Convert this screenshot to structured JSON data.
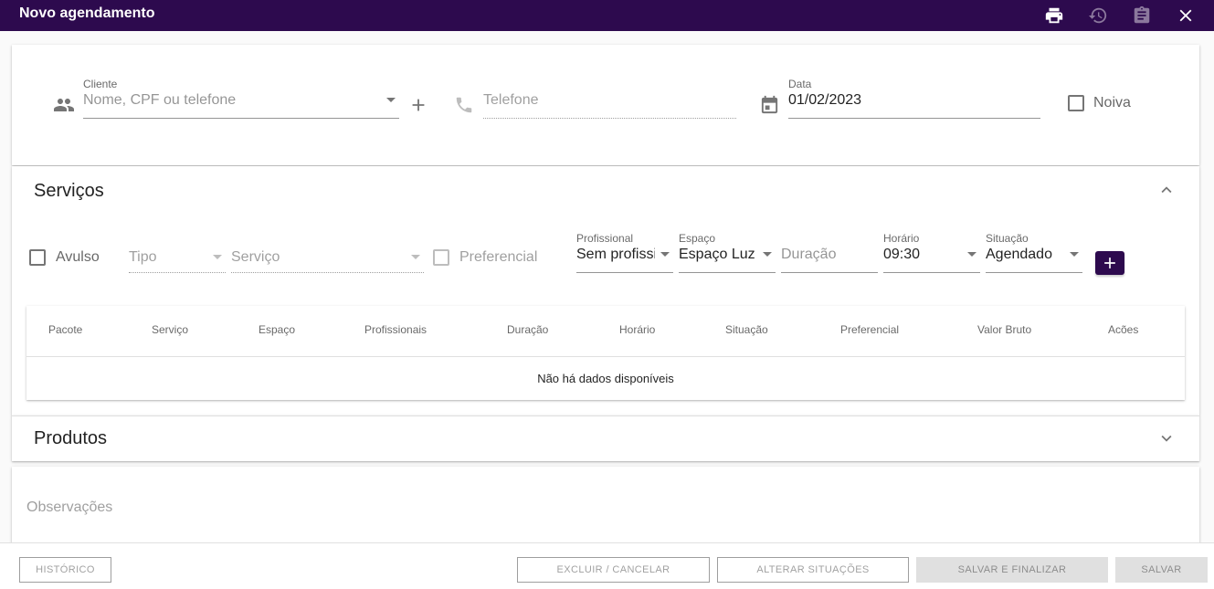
{
  "header": {
    "title": "Novo agendamento",
    "actions": [
      {
        "name": "print-icon"
      },
      {
        "name": "history-icon"
      },
      {
        "name": "clipboard-icon"
      },
      {
        "name": "close-icon"
      }
    ]
  },
  "client_section": {
    "cliente": {
      "label": "Cliente",
      "placeholder": "Nome, CPF ou telefone"
    },
    "telefone": {
      "placeholder": "Telefone"
    },
    "data": {
      "label": "Data",
      "value": "01/02/2023"
    },
    "noiva": {
      "label": "Noiva",
      "checked": false
    }
  },
  "servicos": {
    "title": "Serviços",
    "avulso": {
      "label": "Avulso",
      "checked": false
    },
    "tipo": {
      "placeholder": "Tipo"
    },
    "servico": {
      "placeholder": "Serviço"
    },
    "preferencial": {
      "label": "Preferencial",
      "checked": false
    },
    "profissional": {
      "label": "Profissional",
      "value": "Sem profissional"
    },
    "espaco": {
      "label": "Espaço",
      "value": "Espaço Luz"
    },
    "duracao": {
      "placeholder": "Duração"
    },
    "horario": {
      "label": "Horário",
      "value": "09:30"
    },
    "situacao": {
      "label": "Situação",
      "value": "Agendado"
    },
    "table": {
      "columns": [
        "Pacote",
        "Serviço",
        "Espaço",
        "Profissionais",
        "Duração",
        "Horário",
        "Situação",
        "Preferencial",
        "Valor Bruto",
        "Acões"
      ],
      "empty_text": "Não há dados disponíveis"
    }
  },
  "produtos": {
    "title": "Produtos"
  },
  "observacoes": {
    "label": "Observações"
  },
  "footer": {
    "historico": "HISTÓRICO",
    "excluir": "EXCLUIR / CANCELAR",
    "alterar": "ALTERAR SITUAÇÕES",
    "salvar_finalizar": "SALVAR E FINALIZAR",
    "salvar": "SALVAR"
  },
  "colors": {
    "brand": "#2d0a4e",
    "disabled_button": "#e0e0e0"
  }
}
